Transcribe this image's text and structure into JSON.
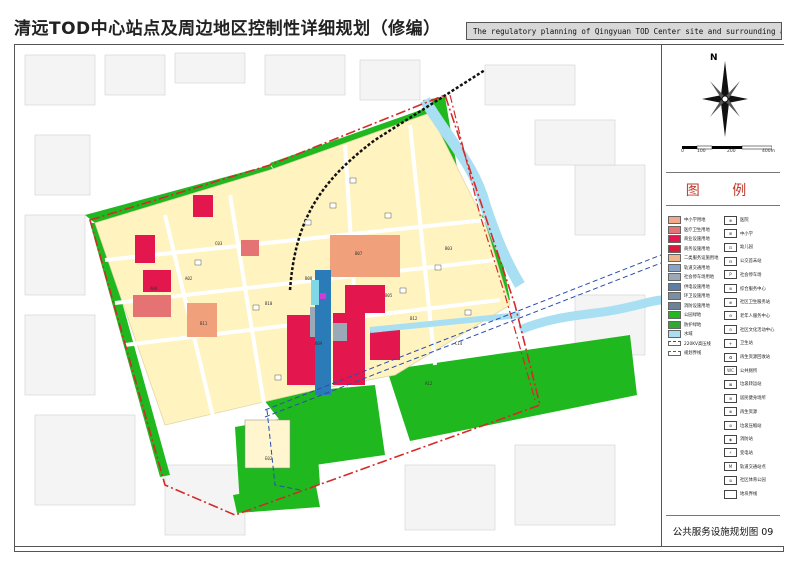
{
  "title": "清远TOD中心站点及周边地区控制性详细规划（修编）",
  "title_en": "The regulatory planning of Qingyuan TOD Center site and surrounding area",
  "legend": {
    "heading": "图 例",
    "land_use": [
      {
        "label": "中小学用地",
        "color": "#f2a98a"
      },
      {
        "label": "医疗卫生用地",
        "color": "#e57373"
      },
      {
        "label": "商业设施用地",
        "color": "#e3174e"
      },
      {
        "label": "商务设施用地",
        "color": "#d81b3b"
      },
      {
        "label": "二类服务设施用地",
        "color": "#f0b48c"
      },
      {
        "label": "轨道交通用地",
        "color": "#8aa3c4"
      },
      {
        "label": "社会停车场用地",
        "color": "#9aa9b8"
      },
      {
        "label": "供电设施用地",
        "color": "#5c7fa8"
      },
      {
        "label": "环卫设施用地",
        "color": "#7b8fa3"
      },
      {
        "label": "消防设施用地",
        "color": "#6d8199"
      },
      {
        "label": "公园绿地",
        "color": "#1fb81f"
      },
      {
        "label": "防护绿地",
        "color": "#33a733"
      },
      {
        "label": "水域",
        "color": "#a8dff2"
      },
      {
        "label": "220KV高压线",
        "color": "#2a4db0"
      },
      {
        "label": "规划界线",
        "color": "#d42a2a"
      }
    ],
    "symbols": [
      {
        "label": "医院"
      },
      {
        "label": "中小学"
      },
      {
        "label": "幼儿园"
      },
      {
        "label": "公交首末站"
      },
      {
        "label": "社会停车场"
      },
      {
        "label": "综合服务中心"
      },
      {
        "label": "社区卫生服务站"
      },
      {
        "label": "老年人服务中心"
      },
      {
        "label": "社区文化活动中心"
      },
      {
        "label": "卫生站"
      },
      {
        "label": "再生资源回收站"
      },
      {
        "label": "公共厕所"
      },
      {
        "label": "垃圾转运站"
      },
      {
        "label": "居民健身场所"
      },
      {
        "label": "再生资源"
      },
      {
        "label": "垃圾压缩站"
      },
      {
        "label": "消防站"
      },
      {
        "label": "变电站"
      },
      {
        "label": "轨道交通站点"
      },
      {
        "label": "社区体育公园"
      },
      {
        "label": "地块界线"
      }
    ]
  },
  "scale": {
    "labels": [
      "0",
      "100",
      "200",
      "400m"
    ]
  },
  "north_label": "N",
  "footer": "公共服务设施规划图 09",
  "parcel_codes": [
    "E02",
    "C03",
    "B11",
    "B08",
    "B07",
    "B05",
    "B12",
    "C14",
    "B09",
    "A08",
    "B03",
    "B10",
    "A02",
    "A12"
  ],
  "colors": {
    "background_green": "#00a651",
    "residential": "#fff7c8",
    "road": "#ffffff",
    "red_boundary": "#d42a2a",
    "blue_line": "#2a4db0",
    "water": "#a8dff2"
  }
}
